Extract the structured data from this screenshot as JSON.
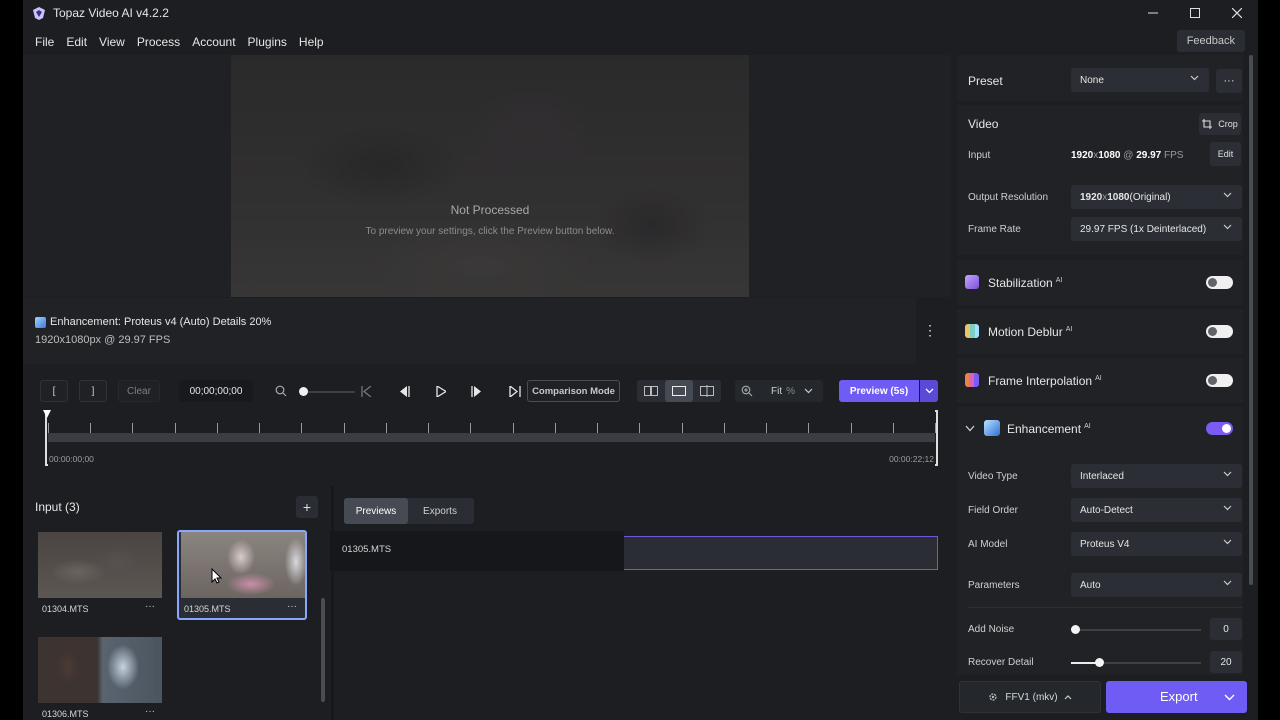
{
  "app": {
    "title": "Topaz Video AI  v4.2.2"
  },
  "menu": [
    "File",
    "Edit",
    "View",
    "Process",
    "Account",
    "Plugins",
    "Help"
  ],
  "feedback_label": "Feedback",
  "preview": {
    "status_title": "Not Processed",
    "status_subtitle": "To preview your settings, click the Preview button below."
  },
  "info": {
    "enhancement": "Enhancement: Proteus v4 (Auto) Details 20%",
    "resolution": "1920x1080px @ 29.97 FPS"
  },
  "transport": {
    "mark_in": "[",
    "mark_out": "]",
    "clear": "Clear",
    "timecode": "00;00;00;00",
    "comparison_mode": "Comparison Mode",
    "fit": "Fit",
    "fit_unit": "%",
    "preview_label": "Preview (5s)"
  },
  "timeline": {
    "start": "00:00:00;00",
    "end": "00:00:22;12"
  },
  "input": {
    "title": "Input (3)",
    "add": "+",
    "files": [
      {
        "name": "01304.MTS",
        "selected": false
      },
      {
        "name": "01305.MTS",
        "selected": true
      },
      {
        "name": "01306.MTS",
        "selected": false
      }
    ],
    "more": "···"
  },
  "previews_panel": {
    "tabs": [
      "Previews",
      "Exports"
    ],
    "active_tab": "Previews",
    "clip": "01305.MTS"
  },
  "settings": {
    "preset_label": "Preset",
    "preset_value": "None",
    "more": "···",
    "video_title": "Video",
    "crop_label": "Crop",
    "input_label": "Input",
    "input_res": "1920",
    "input_x": "x",
    "input_res_h": "1080",
    "input_at": " @ ",
    "input_fps": "29.97",
    "input_fps_unit": " FPS",
    "edit_label": "Edit",
    "output_res_label": "Output Resolution",
    "output_res_value": "1920",
    "output_res_x": "x",
    "output_res_h": "1080",
    "output_res_note": " (Original)",
    "frame_rate_label": "Frame Rate",
    "frame_rate_value": "29.97 FPS (1x Deinterlaced)",
    "ai_badge": "AI",
    "stabilization": {
      "label": "Stabilization",
      "enabled": false
    },
    "motion_deblur": {
      "label": "Motion Deblur",
      "enabled": false
    },
    "frame_interpolation": {
      "label": "Frame Interpolation",
      "enabled": false
    },
    "enhancement": {
      "label": "Enhancement",
      "enabled": true
    },
    "video_type_label": "Video Type",
    "video_type_value": "Interlaced",
    "field_order_label": "Field Order",
    "field_order_value": "Auto-Detect",
    "ai_model_label": "AI Model",
    "ai_model_value": "Proteus V4",
    "parameters_label": "Parameters",
    "parameters_value": "Auto",
    "add_noise_label": "Add Noise",
    "add_noise_value": "0",
    "recover_detail_label": "Recover Detail",
    "recover_detail_value": "20",
    "codec_label": "FFV1 (mkv)",
    "export_label": "Export"
  },
  "colors": {
    "accent": "#6e5cf4",
    "panel": "#1c1e22"
  }
}
